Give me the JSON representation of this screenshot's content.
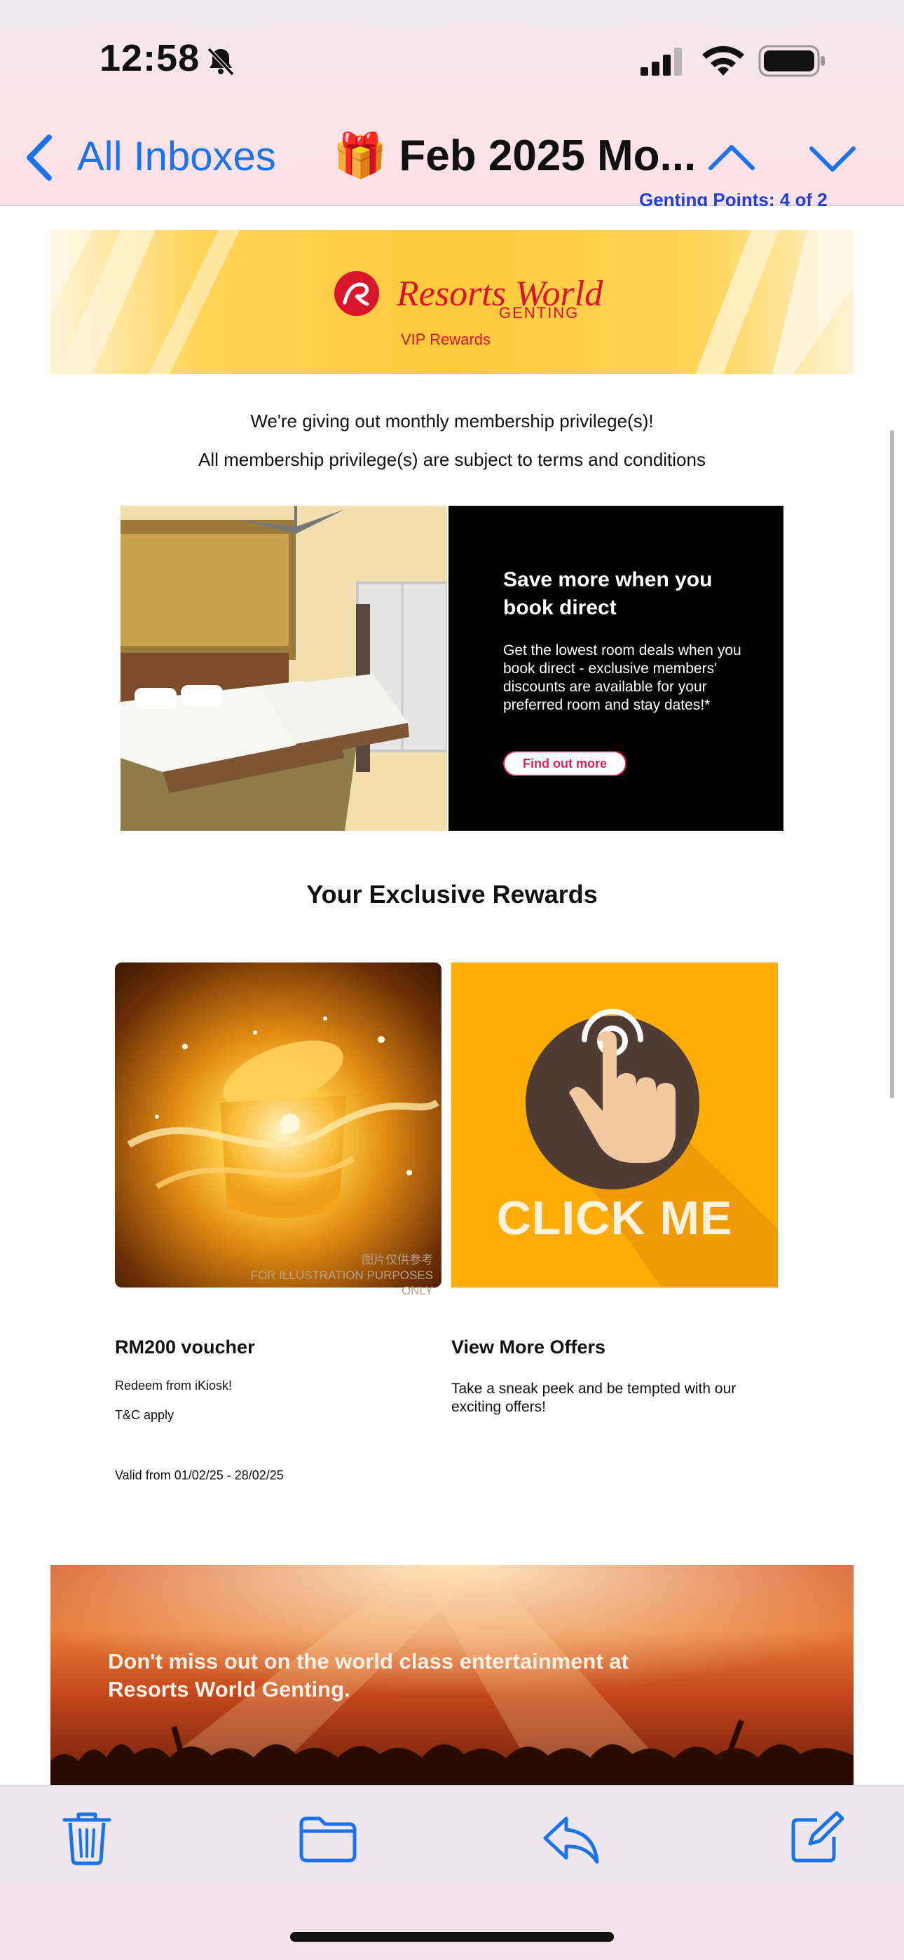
{
  "status_bar": {
    "time": "12:58"
  },
  "nav": {
    "back_label": "All Inboxes",
    "subject": "🎁 Feb 2025 Mo..."
  },
  "email": {
    "partial_top_text": "Genting Points: 4 of 2",
    "banner": {
      "brand": "Resorts World",
      "sub": "GENTING",
      "tagline": "VIP Rewards"
    },
    "intro_line1": "We're giving out monthly membership privilege(s)!",
    "intro_line2": "All membership privilege(s) are subject to terms and conditions",
    "promo": {
      "title": "Save more when you book direct",
      "body": "Get the lowest room deals when you book direct - exclusive members' discounts are available for your preferred room and stay dates!*",
      "button": "Find out more"
    },
    "rewards_heading": "Your Exclusive Rewards",
    "reward1": {
      "image_watermark_cn": "图片仅供参考",
      "image_watermark_en": "FOR ILLUSTRATION PURPOSES ONLY",
      "title": "RM200 voucher",
      "line1": "Redeem from iKiosk!",
      "line2": "T&C apply",
      "valid": "Valid from 01/02/25 - 28/02/25"
    },
    "reward2": {
      "image_text": "CLICK ME",
      "title": "View More Offers",
      "body": "Take a sneak peek and be tempted with our exciting offers!"
    },
    "entertainment_banner": "Don't miss out on the world class entertainment at Resorts World Genting."
  },
  "toolbar": {
    "icons": [
      "trash-icon",
      "folder-icon",
      "reply-icon",
      "compose-icon"
    ]
  },
  "colors": {
    "accent": "#1a73e8",
    "brand_red": "#d8162b",
    "promo_button": "#e0205a",
    "click_me_bg": "#ffad05"
  }
}
